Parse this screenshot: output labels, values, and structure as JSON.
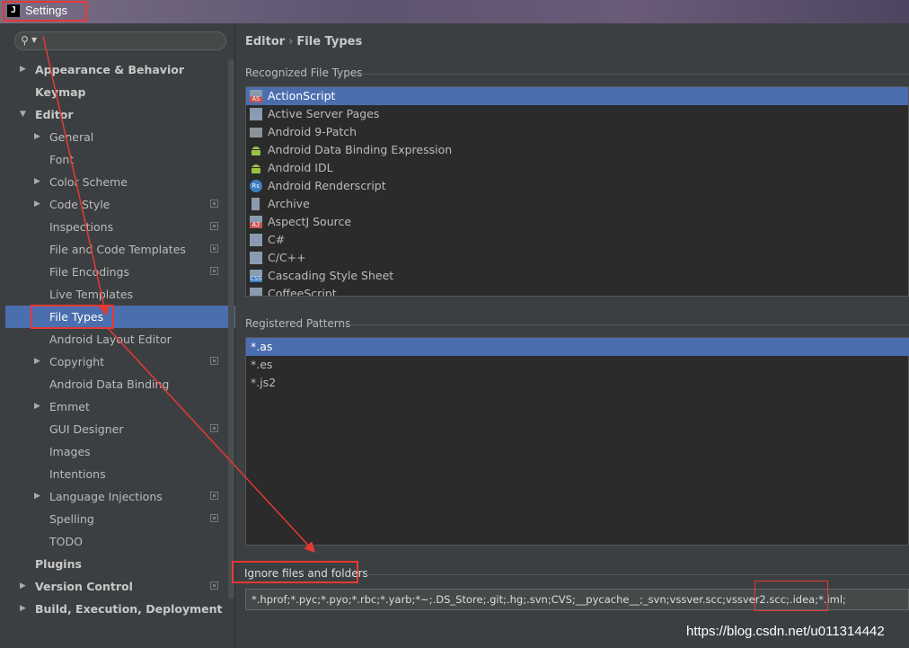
{
  "window": {
    "title": "Settings",
    "logo": "J"
  },
  "search": {
    "icon": "search-icon"
  },
  "sidebar": {
    "items": [
      {
        "label": "Appearance & Behavior",
        "level": 0,
        "bold": true,
        "arrow": "collapsed",
        "project": false
      },
      {
        "label": "Keymap",
        "level": 0,
        "bold": true,
        "arrow": "none",
        "project": false
      },
      {
        "label": "Editor",
        "level": 0,
        "bold": true,
        "arrow": "expanded",
        "project": false
      },
      {
        "label": "General",
        "level": 1,
        "bold": false,
        "arrow": "collapsed",
        "project": false
      },
      {
        "label": "Font",
        "level": 1,
        "bold": false,
        "arrow": "none",
        "project": false
      },
      {
        "label": "Color Scheme",
        "level": 1,
        "bold": false,
        "arrow": "collapsed",
        "project": false
      },
      {
        "label": "Code Style",
        "level": 1,
        "bold": false,
        "arrow": "collapsed",
        "project": true
      },
      {
        "label": "Inspections",
        "level": 1,
        "bold": false,
        "arrow": "none",
        "project": true
      },
      {
        "label": "File and Code Templates",
        "level": 1,
        "bold": false,
        "arrow": "none",
        "project": true
      },
      {
        "label": "File Encodings",
        "level": 1,
        "bold": false,
        "arrow": "none",
        "project": true
      },
      {
        "label": "Live Templates",
        "level": 1,
        "bold": false,
        "arrow": "none",
        "project": false
      },
      {
        "label": "File Types",
        "level": 1,
        "bold": false,
        "arrow": "none",
        "project": false,
        "selected": true
      },
      {
        "label": "Android Layout Editor",
        "level": 1,
        "bold": false,
        "arrow": "none",
        "project": false
      },
      {
        "label": "Copyright",
        "level": 1,
        "bold": false,
        "arrow": "collapsed",
        "project": true
      },
      {
        "label": "Android Data Binding",
        "level": 1,
        "bold": false,
        "arrow": "none",
        "project": false
      },
      {
        "label": "Emmet",
        "level": 1,
        "bold": false,
        "arrow": "collapsed",
        "project": false
      },
      {
        "label": "GUI Designer",
        "level": 1,
        "bold": false,
        "arrow": "none",
        "project": true
      },
      {
        "label": "Images",
        "level": 1,
        "bold": false,
        "arrow": "none",
        "project": false
      },
      {
        "label": "Intentions",
        "level": 1,
        "bold": false,
        "arrow": "none",
        "project": false
      },
      {
        "label": "Language Injections",
        "level": 1,
        "bold": false,
        "arrow": "collapsed",
        "project": true
      },
      {
        "label": "Spelling",
        "level": 1,
        "bold": false,
        "arrow": "none",
        "project": true
      },
      {
        "label": "TODO",
        "level": 1,
        "bold": false,
        "arrow": "none",
        "project": false
      },
      {
        "label": "Plugins",
        "level": 0,
        "bold": true,
        "arrow": "none",
        "project": false
      },
      {
        "label": "Version Control",
        "level": 0,
        "bold": true,
        "arrow": "collapsed",
        "project": true
      },
      {
        "label": "Build, Execution, Deployment",
        "level": 0,
        "bold": true,
        "arrow": "collapsed",
        "project": false
      }
    ]
  },
  "breadcrumb": {
    "parent": "Editor",
    "separator": "›",
    "current": "File Types"
  },
  "recognized": {
    "label": "Recognized File Types",
    "items": [
      {
        "label": "ActionScript",
        "icon": "actionscript-icon",
        "badge": "AS",
        "color": "#c75450",
        "selected": true
      },
      {
        "label": "Active Server Pages",
        "icon": "asp-icon",
        "badge": "",
        "color": "#8a9bb0"
      },
      {
        "label": "Android 9-Patch",
        "icon": "folder-icon",
        "badge": "",
        "color": "#8c9398"
      },
      {
        "label": "Android Data Binding Expression",
        "icon": "android-icon",
        "badge": "",
        "color": "#9ac346"
      },
      {
        "label": "Android IDL",
        "icon": "android-icon",
        "badge": "",
        "color": "#9ac346"
      },
      {
        "label": "Android Renderscript",
        "icon": "renderscript-icon",
        "badge": "Rs",
        "color": "#3d7dc1"
      },
      {
        "label": "Archive",
        "icon": "archive-icon",
        "badge": "",
        "color": "#8a9bb0"
      },
      {
        "label": "AspectJ Source",
        "icon": "aspectj-icon",
        "badge": "AJ",
        "color": "#c75450"
      },
      {
        "label": "C#",
        "icon": "csharp-icon",
        "badge": "",
        "color": "#8a9bb0"
      },
      {
        "label": "C/C++",
        "icon": "cpp-icon",
        "badge": "",
        "color": "#8a9bb0"
      },
      {
        "label": "Cascading Style Sheet",
        "icon": "css-icon",
        "badge": "CSS",
        "color": "#3d7dc1"
      },
      {
        "label": "CoffeeScript",
        "icon": "coffeescript-icon",
        "badge": "",
        "color": "#8a9bb0"
      }
    ]
  },
  "patterns": {
    "label": "Registered Patterns",
    "items": [
      {
        "label": "*.as",
        "selected": true
      },
      {
        "label": "*.es"
      },
      {
        "label": "*.js2"
      }
    ]
  },
  "ignore": {
    "label": "Ignore files and folders",
    "value": "*.hprof;*.pyc;*.pyo;*.rbc;*.yarb;*~;.DS_Store;.git;.hg;.svn;CVS;__pycache__;_svn;vssver.scc;vssver2.scc;.idea;*.iml;"
  },
  "watermark": "https://blog.csdn.net/u011314442",
  "colors": {
    "selection": "#4b6eaf",
    "annotation": "#e53935",
    "panel": "#3c3f41",
    "list_bg": "#2b2b2b"
  }
}
